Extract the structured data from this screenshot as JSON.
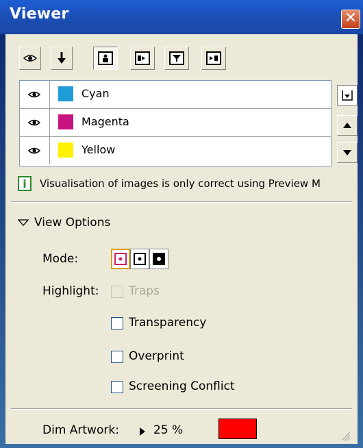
{
  "window": {
    "title": "Viewer",
    "close_label": "✕"
  },
  "toolbar": {
    "buttons": [
      {
        "name": "eye-icon"
      },
      {
        "name": "download-arrow-icon"
      },
      {
        "name": "view-mode-1-icon"
      },
      {
        "name": "view-mode-2-icon"
      },
      {
        "name": "view-mode-3-icon"
      },
      {
        "name": "view-mode-4-icon"
      }
    ]
  },
  "separations": [
    {
      "name": "Cyan",
      "color": "#1f9bd8"
    },
    {
      "name": "Magenta",
      "color": "#c8127f"
    },
    {
      "name": "Yellow",
      "color": "#fff200"
    }
  ],
  "info_message": "Visualisation of images is only correct using Preview M",
  "view_options": {
    "label": "View Options",
    "mode_label": "Mode:",
    "highlight_label": "Highlight:",
    "checkboxes": [
      {
        "label": "Traps",
        "enabled": false,
        "checked": false
      },
      {
        "label": "Transparency",
        "enabled": true,
        "checked": false
      },
      {
        "label": "Overprint",
        "enabled": true,
        "checked": false
      },
      {
        "label": "Screening Conflict",
        "enabled": true,
        "checked": false
      }
    ]
  },
  "dim_artwork": {
    "label": "Dim Artwork:",
    "value": "25 %",
    "color": "#ff0000"
  }
}
